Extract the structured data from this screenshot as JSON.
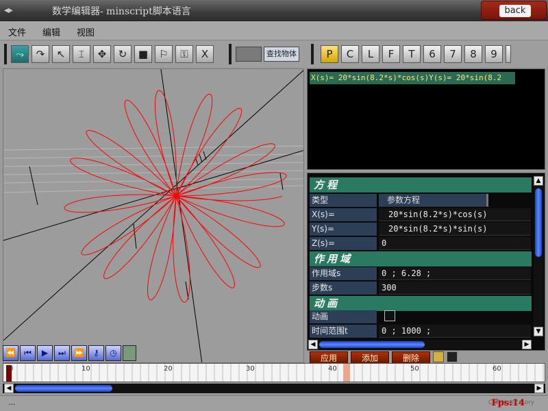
{
  "window": {
    "title": "数学编辑器-  minscript脚本语言",
    "back_label": "back",
    "app_icon": "app-icon"
  },
  "menu": [
    "文件",
    "编辑",
    "视图"
  ],
  "toolbar": {
    "tools": [
      {
        "name": "curve-icon",
        "glyph": "⤳",
        "active": true
      },
      {
        "name": "rotate-view-icon",
        "glyph": "↷"
      },
      {
        "name": "pointer-icon",
        "glyph": "↖"
      },
      {
        "name": "text-cursor-icon",
        "glyph": "⌶"
      },
      {
        "name": "move-icon",
        "glyph": "✥"
      },
      {
        "name": "refresh-icon",
        "glyph": "↻"
      },
      {
        "name": "stop-icon",
        "glyph": "■"
      },
      {
        "name": "mirror-icon",
        "glyph": "⚐"
      },
      {
        "name": "lock-icon",
        "glyph": "🔒"
      },
      {
        "name": "delete-icon",
        "glyph": "X"
      }
    ],
    "search_label": "查找物体",
    "letters": [
      "P",
      "C",
      "L",
      "F",
      "T",
      "6",
      "7",
      "8",
      "9"
    ],
    "active_letter": "P"
  },
  "formula": {
    "text": "X(s)=  20*sin(8.2*s)*cos(s)Y(s)=  20*sin(8.2"
  },
  "properties": {
    "equation_header": "方程",
    "type_label": "类型",
    "type_value": "参数方程",
    "x_label": "X(s)=",
    "x_value": "20*sin(8.2*s)*cos(s)",
    "y_label": "Y(s)=",
    "y_value": "20*sin(8.2*s)*sin(s)",
    "z_label": "Z(s)=",
    "z_value": "0",
    "domain_header": "作用域",
    "domain_label": "作用域s",
    "domain_value": "0  ;  6.28  ;",
    "steps_label": "步数s",
    "steps_value": "300",
    "anim_header": "动画",
    "anim_label": "动画",
    "anim_checked": false,
    "time_label": "时间范围t",
    "time_value": "0  ;  1000  ;"
  },
  "actions": {
    "apply": "应用",
    "add": "添加",
    "delete": "删除"
  },
  "timeline": {
    "ticks": [
      "0",
      "10",
      "20",
      "30",
      "40",
      "50",
      "60"
    ]
  },
  "status": {
    "text": "...",
    "fps": "Fps:14",
    "watermark": "CSDN @Zxtory"
  },
  "curve": {
    "color": "#ff0000",
    "amplitude": 20,
    "frequency": 8.2,
    "s_range": [
      0,
      6.28
    ]
  }
}
